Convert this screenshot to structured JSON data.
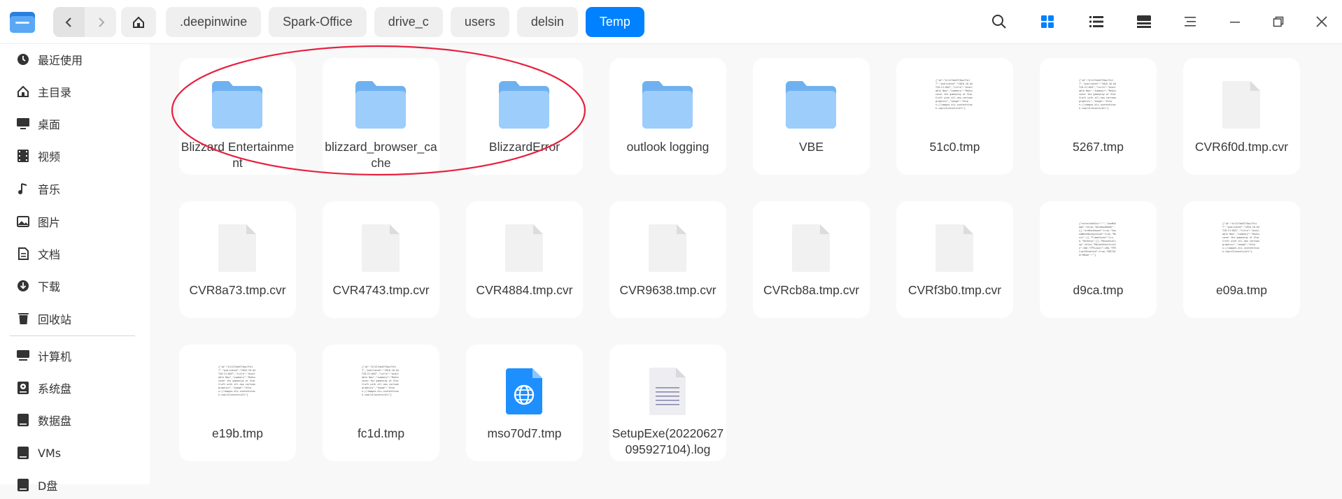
{
  "breadcrumbs": [
    ".deepinwine",
    "Spark-Office",
    "drive_c",
    "users",
    "delsin",
    "Temp"
  ],
  "sidebar": {
    "items": [
      {
        "label": "最近使用",
        "icon": "clock-icon"
      },
      {
        "label": "主目录",
        "icon": "home-icon"
      },
      {
        "label": "桌面",
        "icon": "desktop-icon"
      },
      {
        "label": "视频",
        "icon": "video-icon"
      },
      {
        "label": "音乐",
        "icon": "music-icon"
      },
      {
        "label": "图片",
        "icon": "picture-icon"
      },
      {
        "label": "文档",
        "icon": "document-icon"
      },
      {
        "label": "下载",
        "icon": "download-icon"
      },
      {
        "label": "回收站",
        "icon": "trash-icon"
      },
      {
        "label": "计算机",
        "icon": "computer-icon"
      },
      {
        "label": "系统盘",
        "icon": "system-disk-icon"
      },
      {
        "label": "数据盘",
        "icon": "disk-icon"
      },
      {
        "label": "VMs",
        "icon": "disk-icon"
      },
      {
        "label": "D盘",
        "icon": "disk-icon"
      }
    ]
  },
  "files": [
    {
      "name": "Blizzard Entertainment",
      "kind": "folder"
    },
    {
      "name": "blizzard_browser_cache",
      "kind": "folder"
    },
    {
      "name": "BlizzardError",
      "kind": "folder"
    },
    {
      "name": "outlook logging",
      "kind": "folder"
    },
    {
      "name": "VBE",
      "kind": "folder"
    },
    {
      "name": "51c0.tmp",
      "kind": "json"
    },
    {
      "name": "5267.tmp",
      "kind": "json"
    },
    {
      "name": "CVR6f0d.tmp.cvr",
      "kind": "blank"
    },
    {
      "name": "CVR8a73.tmp.cvr",
      "kind": "blank"
    },
    {
      "name": "CVR4743.tmp.cvr",
      "kind": "blank"
    },
    {
      "name": "CVR4884.tmp.cvr",
      "kind": "blank"
    },
    {
      "name": "CVR9638.tmp.cvr",
      "kind": "blank"
    },
    {
      "name": "CVRcb8a.tmp.cvr",
      "kind": "blank"
    },
    {
      "name": "CVRf3b0.tmp.cvr",
      "kind": "blank"
    },
    {
      "name": "d9ca.tmp",
      "kind": "json2"
    },
    {
      "name": "e09a.tmp",
      "kind": "json"
    },
    {
      "name": "e19b.tmp",
      "kind": "json"
    },
    {
      "name": "fc1d.tmp",
      "kind": "json"
    },
    {
      "name": "mso70d7.tmp",
      "kind": "web"
    },
    {
      "name": "SetupExe(20220627095927104).log",
      "kind": "log"
    }
  ],
  "thumb_text": {
    "json": "{\"id\":\"blt27de67f0ac7fe17\",\"published\":\"2016-10-04T20:21:00Z\",\"title\":\"Available Now\",\"summary\":\"Rediscover the gameplay of StarCraft with all-new cartoon graphics\",\"image\":\"https://images.blz-contentstack.com/v3/assets/blt\"}",
    "json2": "{\"selectedSkin\":\"\",\"useMsEdge\":false,\"WindowsMode\":[],\"areWindowed\":true,\"SoundWhenBackground\":true,\"Music\":[],\"FrameCount\":true,\"Hotkeys\":[],\"MouseScaling\":false,\"MouseSensitivity\":100,\"FPSLimit\":200,\"FPSLimitEnabled\":true,\"EDITAlertMode\":\"\"}"
  },
  "colors": {
    "accent": "#0081ff",
    "annotation": "#e8203e",
    "folder_back": "#6fb1f0",
    "folder_front": "#9dcdfb"
  }
}
